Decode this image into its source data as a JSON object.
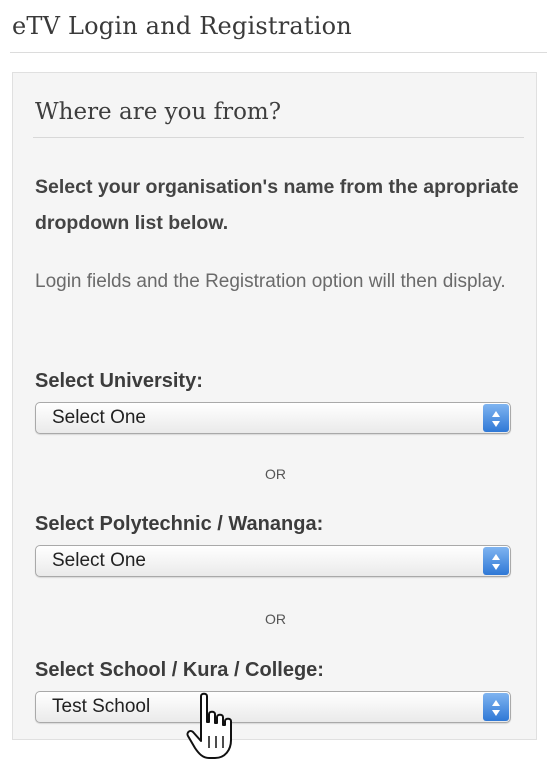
{
  "page": {
    "title": "eTV Login and Registration"
  },
  "panel": {
    "heading": "Where are you from?",
    "instruction": "Select your organisation's name from the apropriate dropdown list below.",
    "note": "Login fields and the Registration option will then display."
  },
  "university": {
    "label": "Select University:",
    "value": "Select One"
  },
  "separator_1": "OR",
  "polytechnic": {
    "label": "Select Polytechnic / Wananga:",
    "value": "Select One"
  },
  "separator_2": "OR",
  "school": {
    "label": "Select School / Kura / College:",
    "value": "Test School"
  },
  "icons": {
    "select_arrows": "updown-arrows-icon",
    "cursor": "hand-pointer-icon"
  },
  "colors": {
    "arrow_button_top": "#7fb4f0",
    "arrow_button_bottom": "#2f78d6",
    "panel_background": "#f5f5f5"
  }
}
